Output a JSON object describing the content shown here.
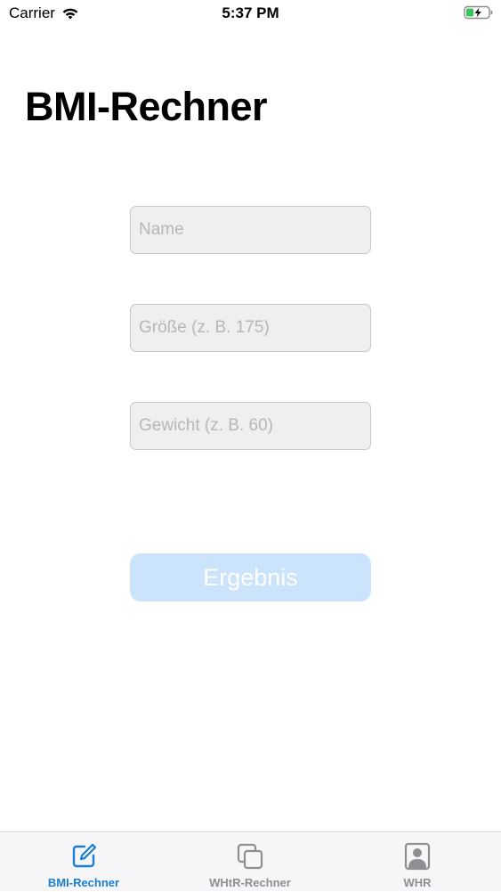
{
  "status_bar": {
    "carrier": "Carrier",
    "time": "5:37 PM"
  },
  "page": {
    "title": "BMI-Rechner"
  },
  "form": {
    "name_placeholder": "Name",
    "name_value": "",
    "height_placeholder": "Größe (z. B. 175)",
    "height_value": "",
    "weight_placeholder": "Gewicht (z. B. 60)",
    "weight_value": "",
    "submit_label": "Ergebnis"
  },
  "tab_bar": {
    "tabs": [
      {
        "label": "BMI-Rechner",
        "icon": "compose-icon",
        "active": true
      },
      {
        "label": "WHtR-Rechner",
        "icon": "copy-icon",
        "active": false
      },
      {
        "label": "WHR",
        "icon": "person-icon",
        "active": false
      }
    ]
  },
  "colors": {
    "accent": "#1a7fd4",
    "button_disabled": "#cbe3fb",
    "battery": "#34c759",
    "inactive": "#8e8e93"
  }
}
